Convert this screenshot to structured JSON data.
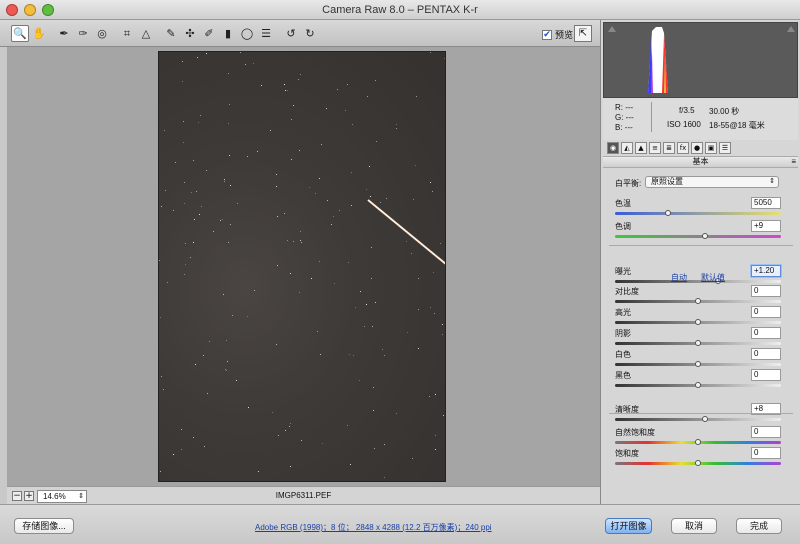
{
  "window": {
    "title": "Camera Raw 8.0 –  PENTAX K-r"
  },
  "toolbar": {
    "tools": [
      {
        "name": "zoom-tool",
        "glyph": "🔍"
      },
      {
        "name": "hand-tool",
        "glyph": "✋"
      },
      {
        "name": "white-balance-tool",
        "glyph": "✒"
      },
      {
        "name": "color-sampler-tool",
        "glyph": "✑"
      },
      {
        "name": "targeted-adjustment-tool",
        "glyph": "◎"
      },
      {
        "name": "crop-tool",
        "glyph": "⌗"
      },
      {
        "name": "straighten-tool",
        "glyph": "△"
      },
      {
        "name": "spot-removal-tool",
        "glyph": "✎"
      },
      {
        "name": "red-eye-tool",
        "glyph": "✣"
      },
      {
        "name": "adjustment-brush-tool",
        "glyph": "✐"
      },
      {
        "name": "graduated-filter-tool",
        "glyph": "▮"
      },
      {
        "name": "radial-filter-tool",
        "glyph": "◯"
      },
      {
        "name": "preferences-tool",
        "glyph": "☰"
      },
      {
        "name": "rotate-ccw-tool",
        "glyph": "↺"
      },
      {
        "name": "rotate-cw-tool",
        "glyph": "↻"
      }
    ],
    "preview_label": "预览",
    "preview_checked": "✔",
    "fullscreen_glyph": "⇱"
  },
  "canvas": {
    "zoom_minus": "−",
    "zoom_plus": "+",
    "zoom_level": "14.6%",
    "zoom_arrow": "⇕",
    "filename": "IMGP6311.PEF"
  },
  "footer": {
    "save_label": "存储图像...",
    "workflow_options": "Adobe RGB (1998)；8 位；  2848 x 4288 (12.2 百万像素)；240 ppi",
    "open_label": "打开图像",
    "cancel_label": "取消",
    "done_label": "完成"
  },
  "info": {
    "r": "R:  ---",
    "g": "G:  ---",
    "b": "B:  ---",
    "aperture": "f/3.5",
    "shutter": "30.00 秒",
    "iso": "ISO 1600",
    "lens": "18-55@18 毫米"
  },
  "panel": {
    "tabs": [
      "◉",
      "◭",
      "▲",
      "≡",
      "≣",
      "fx",
      "●",
      "▣",
      "☰"
    ],
    "section_title": "基本",
    "section_menu": "≡",
    "white_balance_label": "白平衡:",
    "white_balance_value": "原照设置",
    "white_balance_arrow": "⇕",
    "auto_label": "自动",
    "default_label": "默认值"
  },
  "controls": [
    {
      "label": "色温",
      "value": "5050",
      "level": 0.32,
      "track": "temp"
    },
    {
      "label": "色调",
      "value": "+9",
      "level": 0.54,
      "track": "tint"
    },
    {
      "label": "曝光",
      "value": "+1.20",
      "level": 0.62,
      "track": "gray",
      "focused": true
    },
    {
      "label": "对比度",
      "value": "0",
      "level": 0.5,
      "track": "gray"
    },
    {
      "label": "高光",
      "value": "0",
      "level": 0.5,
      "track": "gray"
    },
    {
      "label": "阴影",
      "value": "0",
      "level": 0.5,
      "track": "gray"
    },
    {
      "label": "白色",
      "value": "0",
      "level": 0.5,
      "track": "gray"
    },
    {
      "label": "黑色",
      "value": "0",
      "level": 0.5,
      "track": "gray"
    },
    {
      "label": "清晰度",
      "value": "+8",
      "level": 0.54,
      "track": "gray"
    },
    {
      "label": "自然饱和度",
      "value": "0",
      "level": 0.5,
      "track": "sat"
    },
    {
      "label": "饱和度",
      "value": "0",
      "level": 0.5,
      "track": "sat"
    }
  ],
  "colors": {
    "accent": "#7eb2f0",
    "link": "#1a3fa8",
    "panel_bg": "#d6d6d6",
    "canvas_bg": "#a5a5a5"
  }
}
